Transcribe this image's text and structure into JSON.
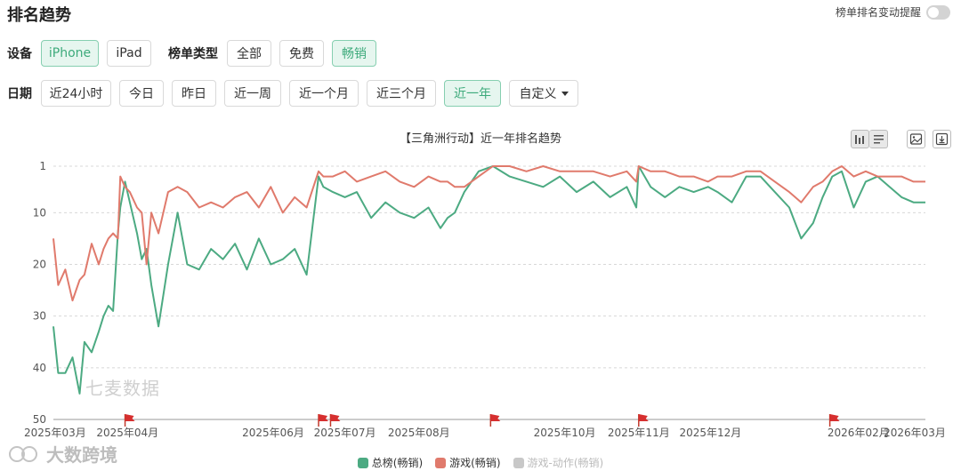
{
  "header": {
    "title": "排名趋势",
    "alert_label": "榜单排名变动提醒"
  },
  "filters": {
    "device_label": "设备",
    "devices": [
      {
        "label": "iPhone",
        "active": true
      },
      {
        "label": "iPad",
        "active": false
      }
    ],
    "chart_type_label": "榜单类型",
    "chart_types": [
      {
        "label": "全部",
        "active": false
      },
      {
        "label": "免费",
        "active": false
      },
      {
        "label": "畅销",
        "active": true
      }
    ],
    "date_label": "日期",
    "dates": [
      {
        "label": "近24小时",
        "active": false
      },
      {
        "label": "今日",
        "active": false
      },
      {
        "label": "昨日",
        "active": false
      },
      {
        "label": "近一周",
        "active": false
      },
      {
        "label": "近一个月",
        "active": false
      },
      {
        "label": "近三个月",
        "active": false
      },
      {
        "label": "近一年",
        "active": true
      }
    ],
    "custom_label": "自定义"
  },
  "toolbar": {
    "icons": [
      "bar-chart-icon",
      "list-icon",
      "image-icon",
      "download-icon"
    ]
  },
  "watermark": "七麦数据",
  "brand": "大数跨境",
  "chart_data": {
    "type": "line",
    "title": "【三角洲行动】近一年排名趋势",
    "xlabel": "",
    "ylabel": "",
    "y_inverted": true,
    "ylim": [
      1,
      50
    ],
    "yticks": [
      1,
      10,
      20,
      30,
      40,
      50
    ],
    "grid": true,
    "legend_position": "bottom",
    "x_range": [
      "2025-03-01",
      "2026-03-01"
    ],
    "xticks": [
      "2025年03月",
      "2025年04月",
      "2025年06月",
      "2025年07月",
      "2025年08月",
      "2025年10月",
      "2025年11月",
      "2025年12月",
      "2026年02月",
      "2026年03月"
    ],
    "xtick_dates": [
      "2025-03-01",
      "2025-04-01",
      "2025-06-01",
      "2025-07-01",
      "2025-08-01",
      "2025-10-01",
      "2025-11-01",
      "2025-12-01",
      "2026-02-01",
      "2026-03-01"
    ],
    "event_flags": [
      "2025-03-31",
      "2025-06-20",
      "2025-06-25",
      "2025-08-31",
      "2025-11-01",
      "2026-01-20"
    ],
    "series": [
      {
        "name": "总榜(畅销)",
        "color": "#4caa82",
        "x": [
          "2025-03-01",
          "2025-03-03",
          "2025-03-06",
          "2025-03-09",
          "2025-03-12",
          "2025-03-14",
          "2025-03-17",
          "2025-03-20",
          "2025-03-22",
          "2025-03-24",
          "2025-03-26",
          "2025-03-28",
          "2025-03-29",
          "2025-03-31",
          "2025-04-02",
          "2025-04-05",
          "2025-04-07",
          "2025-04-09",
          "2025-04-11",
          "2025-04-14",
          "2025-04-18",
          "2025-04-22",
          "2025-04-26",
          "2025-05-01",
          "2025-05-06",
          "2025-05-11",
          "2025-05-16",
          "2025-05-21",
          "2025-05-26",
          "2025-05-31",
          "2025-06-05",
          "2025-06-10",
          "2025-06-15",
          "2025-06-20",
          "2025-06-22",
          "2025-06-26",
          "2025-07-01",
          "2025-07-06",
          "2025-07-12",
          "2025-07-18",
          "2025-07-24",
          "2025-07-30",
          "2025-08-05",
          "2025-08-10",
          "2025-08-13",
          "2025-08-16",
          "2025-08-20",
          "2025-08-26",
          "2025-09-01",
          "2025-09-08",
          "2025-09-15",
          "2025-09-22",
          "2025-09-29",
          "2025-10-06",
          "2025-10-13",
          "2025-10-20",
          "2025-10-27",
          "2025-10-31",
          "2025-11-01",
          "2025-11-06",
          "2025-11-12",
          "2025-11-18",
          "2025-11-24",
          "2025-11-30",
          "2025-12-04",
          "2025-12-10",
          "2025-12-16",
          "2025-12-22",
          "2025-12-28",
          "2026-01-03",
          "2026-01-08",
          "2026-01-13",
          "2026-01-17",
          "2026-01-21",
          "2026-01-25",
          "2026-01-30",
          "2026-02-04",
          "2026-02-09",
          "2026-02-14",
          "2026-02-19",
          "2026-02-24",
          "2026-03-01"
        ],
        "values": [
          32,
          41,
          41,
          38,
          45,
          35,
          37,
          33,
          30,
          28,
          29,
          14,
          9,
          4,
          8,
          14,
          19,
          17,
          24,
          32,
          20,
          10,
          20,
          21,
          17,
          19,
          16,
          21,
          15,
          20,
          19,
          17,
          22,
          3,
          5,
          6,
          7,
          6,
          11,
          8,
          10,
          11,
          9,
          13,
          11,
          10,
          6,
          2,
          1,
          3,
          4,
          5,
          3,
          6,
          4,
          7,
          5,
          9,
          1,
          5,
          7,
          5,
          6,
          5,
          6,
          8,
          3,
          3,
          6,
          9,
          15,
          12,
          7,
          3,
          2,
          9,
          4,
          3,
          5,
          7,
          8,
          8
        ]
      },
      {
        "name": "游戏(畅销)",
        "color": "#e07a6c",
        "x": [
          "2025-03-01",
          "2025-03-03",
          "2025-03-06",
          "2025-03-09",
          "2025-03-12",
          "2025-03-14",
          "2025-03-17",
          "2025-03-20",
          "2025-03-22",
          "2025-03-24",
          "2025-03-26",
          "2025-03-28",
          "2025-03-29",
          "2025-03-31",
          "2025-04-02",
          "2025-04-05",
          "2025-04-07",
          "2025-04-09",
          "2025-04-11",
          "2025-04-14",
          "2025-04-18",
          "2025-04-22",
          "2025-04-26",
          "2025-05-01",
          "2025-05-06",
          "2025-05-11",
          "2025-05-16",
          "2025-05-21",
          "2025-05-26",
          "2025-05-31",
          "2025-06-05",
          "2025-06-10",
          "2025-06-15",
          "2025-06-20",
          "2025-06-22",
          "2025-06-26",
          "2025-07-01",
          "2025-07-06",
          "2025-07-12",
          "2025-07-18",
          "2025-07-24",
          "2025-07-30",
          "2025-08-05",
          "2025-08-10",
          "2025-08-13",
          "2025-08-16",
          "2025-08-20",
          "2025-08-26",
          "2025-09-01",
          "2025-09-08",
          "2025-09-15",
          "2025-09-22",
          "2025-09-29",
          "2025-10-06",
          "2025-10-13",
          "2025-10-20",
          "2025-10-27",
          "2025-10-31",
          "2025-11-01",
          "2025-11-06",
          "2025-11-12",
          "2025-11-18",
          "2025-11-24",
          "2025-11-30",
          "2025-12-04",
          "2025-12-10",
          "2025-12-16",
          "2025-12-22",
          "2025-12-28",
          "2026-01-03",
          "2026-01-08",
          "2026-01-13",
          "2026-01-17",
          "2026-01-21",
          "2026-01-25",
          "2026-01-30",
          "2026-02-04",
          "2026-02-09",
          "2026-02-14",
          "2026-02-19",
          "2026-02-24",
          "2026-03-01"
        ],
        "values": [
          15,
          24,
          21,
          27,
          23,
          22,
          16,
          20,
          17,
          15,
          14,
          15,
          3,
          5,
          6,
          9,
          10,
          20,
          10,
          14,
          6,
          5,
          6,
          9,
          8,
          9,
          7,
          6,
          9,
          5,
          10,
          7,
          9,
          2,
          3,
          3,
          2,
          4,
          3,
          2,
          4,
          5,
          3,
          4,
          4,
          5,
          5,
          3,
          1,
          1,
          2,
          1,
          2,
          2,
          2,
          3,
          2,
          4,
          1,
          2,
          2,
          3,
          3,
          4,
          3,
          3,
          2,
          2,
          4,
          6,
          8,
          5,
          4,
          2,
          1,
          3,
          2,
          3,
          3,
          3,
          4,
          4
        ]
      },
      {
        "name": "游戏-动作(畅销)",
        "color": "#c8c8c8",
        "x": [],
        "values": []
      }
    ]
  }
}
